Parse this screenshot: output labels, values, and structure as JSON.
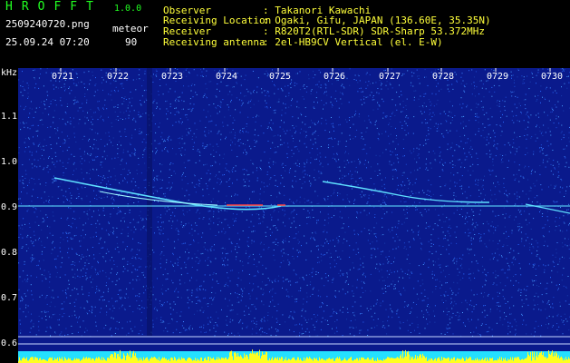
{
  "app": {
    "title": "HROFFT",
    "version": "1.0.0",
    "filename": "2509240720.png",
    "datetime": "25.09.24 07:20",
    "mode_label": "meteor",
    "mode_value": "90"
  },
  "station": {
    "observer_label": "Observer",
    "observer_value": ": Takanori Kawachi",
    "location_label": "Receiving Location",
    "location_value": ": Ogaki, Gifu, JAPAN (136.60E, 35.35N)",
    "receiver_label": "Receiver",
    "receiver_value": ": R820T2(RTL-SDR) SDR-Sharp 53.372MHz",
    "antenna_label": "Receiving antenna",
    "antenna_value": ": 2el-HB9CV Vertical (el. E-W)"
  },
  "axes": {
    "y_unit": "kHz",
    "y_ticks": [
      "1.1",
      "1.0",
      "0.9",
      "0.8",
      "0.7",
      "0.6"
    ],
    "x_ticks": [
      "0721",
      "0722",
      "0723",
      "0724",
      "0725",
      "0726",
      "0727",
      "0728",
      "0729",
      "0730"
    ]
  },
  "colors": {
    "background": "#0a1a8c",
    "noise": "#2a6cff",
    "signal": "#5fe0ff",
    "peak": "#ff4040",
    "bar_cyan": "#24e0ff",
    "bar_yellow": "#ffff20"
  }
}
